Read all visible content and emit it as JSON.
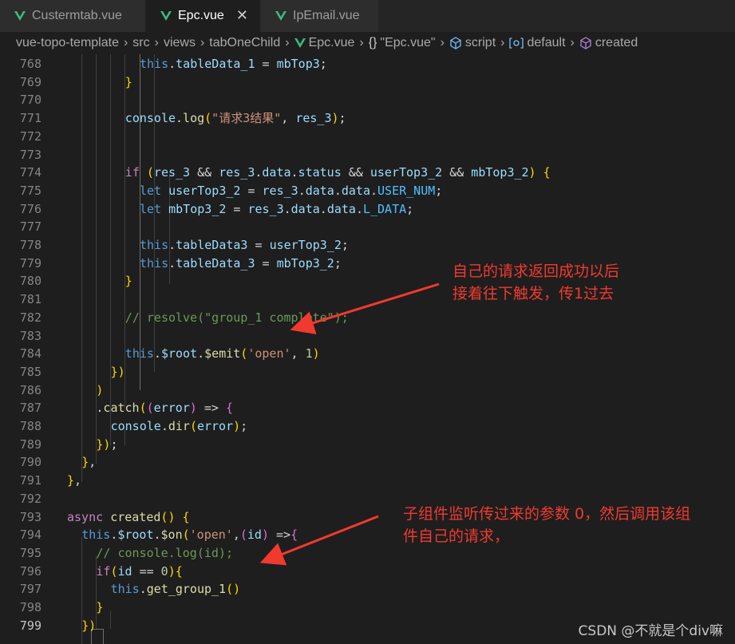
{
  "tabs": [
    {
      "label": "Custermtab.vue",
      "active": false
    },
    {
      "label": "Epc.vue",
      "active": true
    },
    {
      "label": "IpEmail.vue",
      "active": false
    }
  ],
  "breadcrumb": [
    "vue-topo-template",
    "src",
    "views",
    "tabOneChild",
    "Epc.vue",
    "\"Epc.vue\"",
    "script",
    "default",
    "created"
  ],
  "code_lines": [
    {
      "n": "768",
      "text": "          this.tableData_1 = mbTop3;"
    },
    {
      "n": "769",
      "text": "        }"
    },
    {
      "n": "770",
      "text": ""
    },
    {
      "n": "771",
      "text": "        console.log(\"请求3结果\", res_3);"
    },
    {
      "n": "772",
      "text": ""
    },
    {
      "n": "773",
      "text": ""
    },
    {
      "n": "774",
      "text": "        if (res_3 && res_3.data.status && userTop3_2 && mbTop3_2) {"
    },
    {
      "n": "775",
      "text": "          let userTop3_2 = res_3.data.data.USER_NUM;"
    },
    {
      "n": "776",
      "text": "          let mbTop3_2 = res_3.data.data.L_DATA;"
    },
    {
      "n": "777",
      "text": ""
    },
    {
      "n": "778",
      "text": "          this.tableData3 = userTop3_2;"
    },
    {
      "n": "779",
      "text": "          this.tableData_3 = mbTop3_2;"
    },
    {
      "n": "780",
      "text": "        }"
    },
    {
      "n": "781",
      "text": ""
    },
    {
      "n": "782",
      "text": "        // resolve(\"group_1 complete\");"
    },
    {
      "n": "783",
      "text": ""
    },
    {
      "n": "784",
      "text": "        this.$root.$emit('open', 1)"
    },
    {
      "n": "785",
      "text": "      })"
    },
    {
      "n": "786",
      "text": "    )"
    },
    {
      "n": "787",
      "text": "    .catch((error) => {"
    },
    {
      "n": "788",
      "text": "      console.dir(error);"
    },
    {
      "n": "789",
      "text": "    });"
    },
    {
      "n": "790",
      "text": "  },"
    },
    {
      "n": "791",
      "text": "},"
    },
    {
      "n": "792",
      "text": ""
    },
    {
      "n": "793",
      "text": "async created() {"
    },
    {
      "n": "794",
      "text": "  this.$root.$on('open',(id) =>{"
    },
    {
      "n": "795",
      "text": "    // console.log(id);"
    },
    {
      "n": "796",
      "text": "    if(id == 0){"
    },
    {
      "n": "797",
      "text": "      this.get_group_1()"
    },
    {
      "n": "798",
      "text": "    }"
    },
    {
      "n": "799",
      "text": "  })"
    }
  ],
  "current_line": "799",
  "annotations": [
    {
      "lines": [
        "自己的请求返回成功以后",
        "接着往下触发，传1过去"
      ]
    },
    {
      "lines": [
        "子组件监听传过来的参数 0，然后调用该组",
        "件自己的请求，"
      ]
    }
  ],
  "watermark": "CSDN @不就是个div嘛",
  "colors": {
    "accent_red": "#f03a2e",
    "editor_bg": "#1e1e1e",
    "vue_green": "#41b883"
  }
}
